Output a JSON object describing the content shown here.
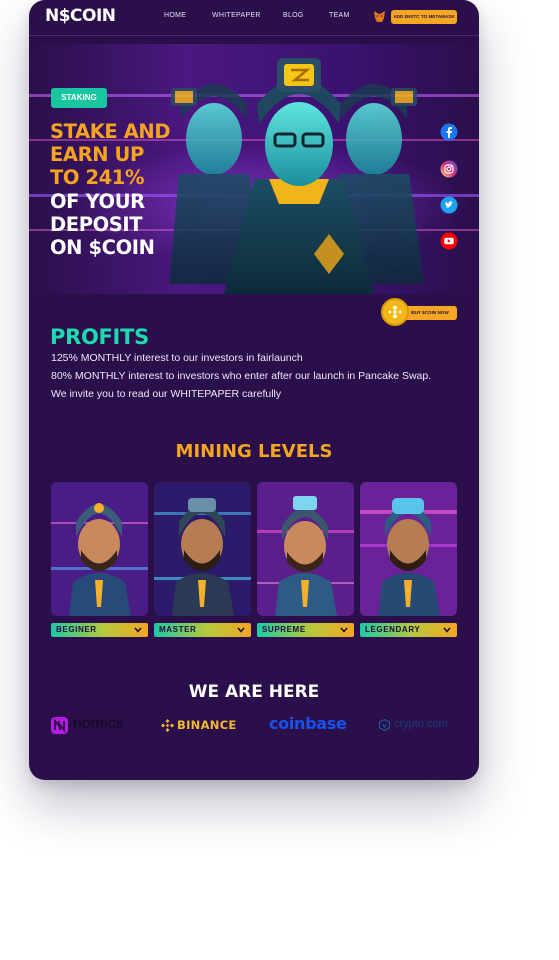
{
  "nav": {
    "logo": "N$COIN",
    "links": [
      "HOME",
      "WHITEPAPER",
      "BLOG",
      "TEAM"
    ],
    "metamask_button": "ADD $NSTC TO METAMASK"
  },
  "hero": {
    "badge": "STAKING",
    "title_lines": [
      "STAKE AND",
      "EARN UP",
      "TO 241%",
      "OF YOUR",
      "DEPOSIT",
      "ON $COIN"
    ],
    "social_icons": [
      "facebook-icon",
      "instagram-icon",
      "twitter-icon",
      "youtube-icon"
    ],
    "buy_button": "BUY $COIN NOW"
  },
  "profits": {
    "title": "PROFITS",
    "lines": [
      "125% MONTHLY interest to our investors in fairlaunch",
      "80% MONTHLY interest to investors who enter after our launch in Pancake Swap.",
      "We invite you to read our WHITEPAPER carefully"
    ]
  },
  "mining": {
    "title": "MINING LEVELS",
    "levels": [
      "BEGINER",
      "MASTER",
      "SUPREME",
      "LEGENDARY"
    ]
  },
  "partners": {
    "title": "WE ARE HERE",
    "names": [
      "nomics",
      "BINANCE",
      "coinbase",
      "crypto.com"
    ]
  },
  "colors": {
    "background": "#2a0f4a",
    "accent_orange": "#f4a521",
    "accent_teal": "#1fd9b0"
  }
}
